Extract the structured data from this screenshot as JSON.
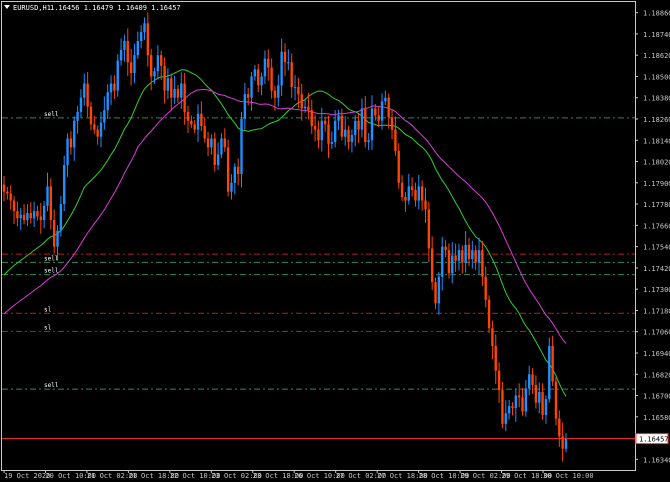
{
  "header": {
    "symbol": "EURUSD,H1",
    "ohlc": "1.16456 1.16479 1.16409 1.16457"
  },
  "colors": {
    "background": "#000000",
    "bull": "#1e90ff",
    "bear": "#ff4500",
    "ma_fast": "#32cd32",
    "ma_slow": "#da3cda",
    "sell_line": "#2e8b57",
    "sl_line": "#b22222",
    "price_line": "#ff3030",
    "axis": "#c8c8c8"
  },
  "price_axis": {
    "labels": [
      "1.18860",
      "1.18740",
      "1.18620",
      "1.18500",
      "1.18380",
      "1.18260",
      "1.18140",
      "1.18020",
      "1.17900",
      "1.17780",
      "1.17660",
      "1.17540",
      "1.17420",
      "1.17300",
      "1.17180",
      "1.17060",
      "1.16940",
      "1.16820",
      "1.16700",
      "1.16580",
      "1.16340"
    ],
    "current_price": "1.16457"
  },
  "time_axis": {
    "labels": [
      "19 Oct 2020",
      "20 Oct 10:00",
      "21 Oct 02:00",
      "21 Oct 18:00",
      "22 Oct 10:00",
      "23 Oct 02:00",
      "23 Oct 18:00",
      "26 Oct 10:00",
      "27 Oct 02:00",
      "27 Oct 18:00",
      "28 Oct 10:00",
      "29 Oct 02:00",
      "29 Oct 18:00",
      "30 Oct 10:00"
    ]
  },
  "levels": [
    {
      "label": "sell",
      "price": 1.18266,
      "kind": "sell"
    },
    {
      "label": "",
      "price": 1.17498,
      "kind": "sl"
    },
    {
      "label": "sell",
      "price": 1.17451,
      "kind": "sell"
    },
    {
      "label": "sell",
      "price": 1.17382,
      "kind": "sell"
    },
    {
      "label": "sl",
      "price": 1.17164,
      "kind": "sl"
    },
    {
      "label": "sl",
      "price": 1.17062,
      "kind": "sl"
    },
    {
      "label": "sell",
      "price": 1.16736,
      "kind": "sell"
    }
  ],
  "chart_data": {
    "type": "candlestick",
    "symbol": "EURUSD",
    "timeframe": "H1",
    "ylim": [
      1.1628,
      1.1892
    ],
    "closes": [
      1.1785,
      1.1784,
      1.178,
      1.1774,
      1.177,
      1.1772,
      1.1769,
      1.1773,
      1.177,
      1.1774,
      1.1771,
      1.1769,
      1.1777,
      1.1788,
      1.1769,
      1.1754,
      1.1763,
      1.1778,
      1.18,
      1.1815,
      1.181,
      1.1825,
      1.183,
      1.1838,
      1.1846,
      1.1833,
      1.1823,
      1.182,
      1.1816,
      1.1824,
      1.1831,
      1.1841,
      1.1846,
      1.1842,
      1.1859,
      1.1865,
      1.187,
      1.1858,
      1.1852,
      1.1862,
      1.187,
      1.1875,
      1.188,
      1.1862,
      1.185,
      1.1853,
      1.1862,
      1.1856,
      1.1842,
      1.1849,
      1.1838,
      1.1843,
      1.1838,
      1.1846,
      1.183,
      1.1825,
      1.1823,
      1.182,
      1.1829,
      1.1822,
      1.1815,
      1.181,
      1.1815,
      1.18,
      1.1806,
      1.1815,
      1.181,
      1.1785,
      1.179,
      1.1799,
      1.1795,
      1.1826,
      1.184,
      1.1838,
      1.185,
      1.1854,
      1.1845,
      1.185,
      1.186,
      1.1855,
      1.1842,
      1.1838,
      1.1845,
      1.1864,
      1.1858,
      1.1858,
      1.1844,
      1.1844,
      1.184,
      1.1832,
      1.1833,
      1.1831,
      1.1822,
      1.182,
      1.1814,
      1.1825,
      1.1823,
      1.1812,
      1.1813,
      1.1825,
      1.1828,
      1.1816,
      1.182,
      1.1813,
      1.1817,
      1.1825,
      1.182,
      1.1832,
      1.1813,
      1.1814,
      1.1832,
      1.1828,
      1.1825,
      1.1836,
      1.1838,
      1.1827,
      1.182,
      1.1808,
      1.179,
      1.1782,
      1.178,
      1.1788,
      1.1786,
      1.178,
      1.1788,
      1.178,
      1.1775,
      1.1753,
      1.1734,
      1.1722,
      1.1737,
      1.1754,
      1.1752,
      1.1739,
      1.1749,
      1.1746,
      1.1752,
      1.1745,
      1.1755,
      1.1747,
      1.1752,
      1.1745,
      1.1752,
      1.1737,
      1.1724,
      1.1708,
      1.1698,
      1.1684,
      1.1673,
      1.1654,
      1.166,
      1.1664,
      1.1663,
      1.167,
      1.1669,
      1.1661,
      1.1674,
      1.1682,
      1.1676,
      1.1666,
      1.1672,
      1.1659,
      1.1668,
      1.1698,
      1.1678,
      1.1657,
      1.1647,
      1.164,
      1.16457
    ],
    "ma_fast_endpoints": [
      "1.17380 (start)",
      "1.16960 (end)"
    ],
    "ma_slow_endpoints": [
      "1.17160 (start)",
      "1.16950 (end)"
    ]
  }
}
